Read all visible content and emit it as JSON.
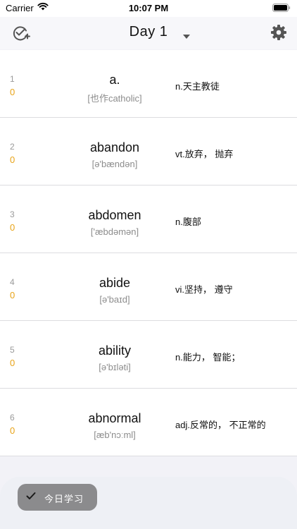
{
  "status_bar": {
    "carrier": "Carrier",
    "time": "10:07 PM"
  },
  "nav": {
    "title": "Day 1",
    "left_icon": "add-check-icon",
    "right_icon": "gear-icon",
    "dropdown_icon": "caret-down-icon"
  },
  "words": [
    {
      "index": "1",
      "count": "0",
      "word": "a.",
      "phonetic": "[也作catholic]",
      "meaning": "n.天主教徒"
    },
    {
      "index": "2",
      "count": "0",
      "word": "abandon",
      "phonetic": "[ə'bændən]",
      "meaning": "vt.放弃， 抛弃"
    },
    {
      "index": "3",
      "count": "0",
      "word": "abdomen",
      "phonetic": "['æbdəmən]",
      "meaning": "n.腹部"
    },
    {
      "index": "4",
      "count": "0",
      "word": "abide",
      "phonetic": "[ə'baɪd]",
      "meaning": "vi.坚持， 遵守"
    },
    {
      "index": "5",
      "count": "0",
      "word": "ability",
      "phonetic": "[ə'bɪləti]",
      "meaning": "n.能力， 智能；"
    },
    {
      "index": "6",
      "count": "0",
      "word": "abnormal",
      "phonetic": "[æb'nɔːml]",
      "meaning": "adj.反常的， 不正常的"
    }
  ],
  "bottom": {
    "study_label": "今日学习",
    "study_icon": "check-icon"
  },
  "colors": {
    "count": "#e8a317",
    "button": "#8b8b8d",
    "nav_bg": "#f7f7fa"
  }
}
